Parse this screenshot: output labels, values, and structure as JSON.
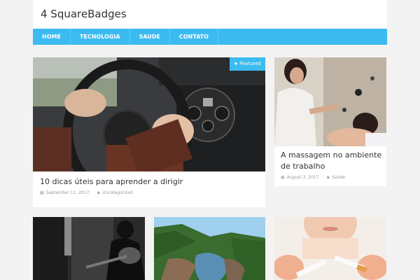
{
  "site": {
    "title": "4 SquareBadges"
  },
  "nav": {
    "items": [
      "HOME",
      "TECNOLOGIA",
      "SAUDE",
      "CONTATO"
    ]
  },
  "featured": {
    "badge": "Featured",
    "title": "10 dicas úteis para aprender a dirigir",
    "date": "September 11, 2017",
    "category": "Uncategorized"
  },
  "side_post": {
    "title": "A massagem no ambiente de trabalho",
    "date": "August 3, 2017",
    "category": "Saúde"
  },
  "icons": {
    "badge": "star-icon",
    "date": "calendar-icon",
    "category": "tag-icon"
  },
  "colors": {
    "accent": "#3bbbf0",
    "background": "#f3f3f3"
  }
}
